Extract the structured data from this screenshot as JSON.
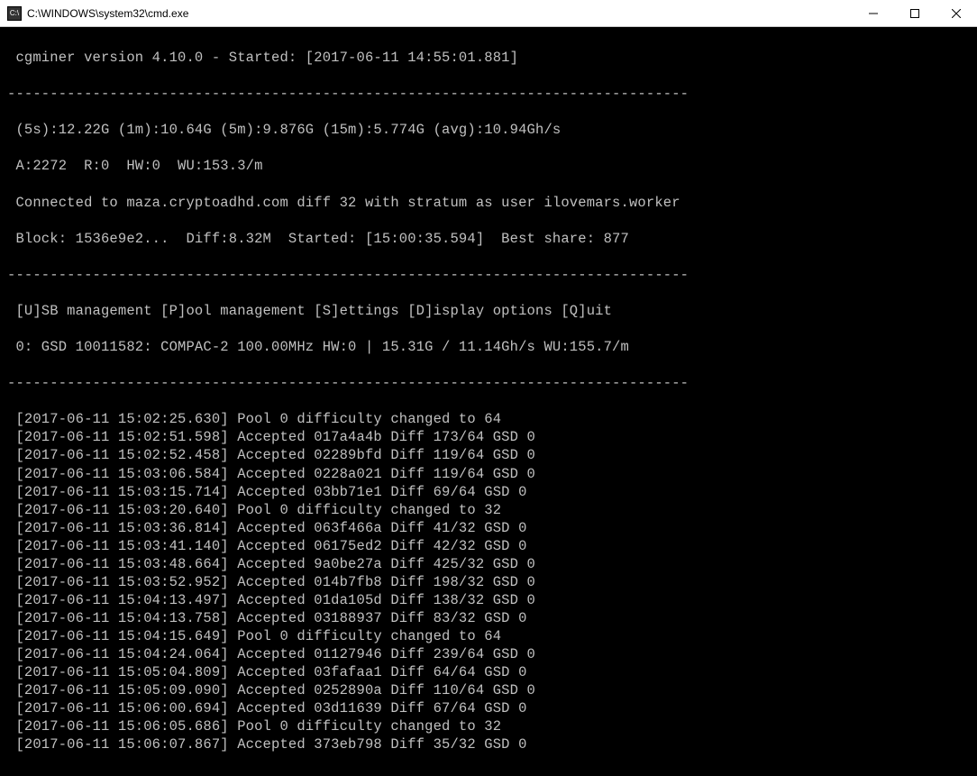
{
  "window": {
    "title": "C:\\WINDOWS\\system32\\cmd.exe"
  },
  "header": {
    "version_line": " cgminer version 4.10.0 - Started: [2017-06-11 14:55:01.881]",
    "separator": "--------------------------------------------------------------------------------",
    "hashrate_line": " (5s):12.22G (1m):10.64G (5m):9.876G (15m):5.774G (avg):10.94Gh/s",
    "stats_line": " A:2272  R:0  HW:0  WU:153.3/m",
    "connection_line": " Connected to maza.cryptoadhd.com diff 32 with stratum as user ilovemars.worker",
    "block_line": " Block: 1536e9e2...  Diff:8.32M  Started: [15:00:35.594]  Best share: 877",
    "menu_line": " [U]SB management [P]ool management [S]ettings [D]isplay options [Q]uit",
    "device_line": " 0: GSD 10011582: COMPAC-2 100.00MHz HW:0 | 15.31G / 11.14Gh/s WU:155.7/m"
  },
  "cgminer": {
    "version": "4.10.0",
    "started": "2017-06-11 14:55:01.881",
    "hashrate_5s": "12.22G",
    "hashrate_1m": "10.64G",
    "hashrate_5m": "9.876G",
    "hashrate_15m": "5.774G",
    "hashrate_avg": "10.94Gh/s",
    "accepted": 2272,
    "rejected": 0,
    "hw_errors": 0,
    "wu": "153.3/m",
    "pool_host": "maza.cryptoadhd.com",
    "pool_diff": 32,
    "pool_user": "ilovemars.worker",
    "block_hash": "1536e9e2...",
    "block_diff": "8.32M",
    "block_started": "15:00:35.594",
    "best_share": 877,
    "device_id": 0,
    "device_serial": "GSD 10011582",
    "device_model": "COMPAC-2",
    "device_freq": "100.00MHz",
    "device_hw": 0,
    "device_rate_5s": "15.31G",
    "device_rate_avg": "11.14Gh/s",
    "device_wu": "155.7/m"
  },
  "log": [
    " [2017-06-11 15:02:25.630] Pool 0 difficulty changed to 64",
    " [2017-06-11 15:02:51.598] Accepted 017a4a4b Diff 173/64 GSD 0",
    " [2017-06-11 15:02:52.458] Accepted 02289bfd Diff 119/64 GSD 0",
    " [2017-06-11 15:03:06.584] Accepted 0228a021 Diff 119/64 GSD 0",
    " [2017-06-11 15:03:15.714] Accepted 03bb71e1 Diff 69/64 GSD 0",
    " [2017-06-11 15:03:20.640] Pool 0 difficulty changed to 32",
    " [2017-06-11 15:03:36.814] Accepted 063f466a Diff 41/32 GSD 0",
    " [2017-06-11 15:03:41.140] Accepted 06175ed2 Diff 42/32 GSD 0",
    " [2017-06-11 15:03:48.664] Accepted 9a0be27a Diff 425/32 GSD 0",
    " [2017-06-11 15:03:52.952] Accepted 014b7fb8 Diff 198/32 GSD 0",
    " [2017-06-11 15:04:13.497] Accepted 01da105d Diff 138/32 GSD 0",
    " [2017-06-11 15:04:13.758] Accepted 03188937 Diff 83/32 GSD 0",
    " [2017-06-11 15:04:15.649] Pool 0 difficulty changed to 64",
    " [2017-06-11 15:04:24.064] Accepted 01127946 Diff 239/64 GSD 0",
    " [2017-06-11 15:05:04.809] Accepted 03fafaa1 Diff 64/64 GSD 0",
    " [2017-06-11 15:05:09.090] Accepted 0252890a Diff 110/64 GSD 0",
    " [2017-06-11 15:06:00.694] Accepted 03d11639 Diff 67/64 GSD 0",
    " [2017-06-11 15:06:05.686] Pool 0 difficulty changed to 32",
    " [2017-06-11 15:06:07.867] Accepted 373eb798 Diff 35/32 GSD 0"
  ]
}
